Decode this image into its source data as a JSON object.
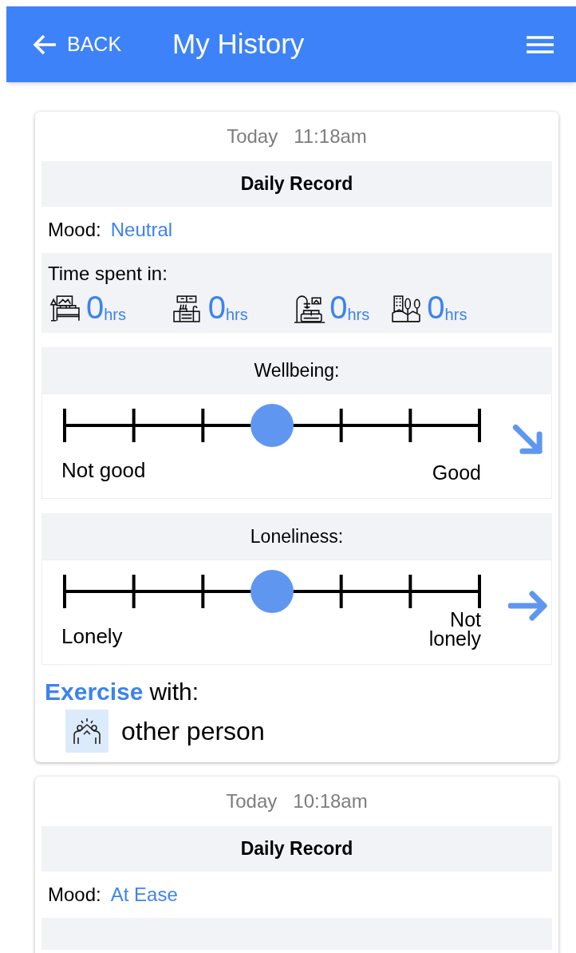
{
  "header": {
    "back_label": "BACK",
    "title": "My History"
  },
  "records": [
    {
      "date": "Today",
      "time": "11:18am",
      "title": "Daily Record",
      "mood_label": "Mood:",
      "mood": "Neutral",
      "time_spent": {
        "label": "Time spent in:",
        "places": [
          {
            "kind": "bedroom",
            "value": "0",
            "unit": "hrs"
          },
          {
            "kind": "kitchen",
            "value": "0",
            "unit": "hrs"
          },
          {
            "kind": "living-room",
            "value": "0",
            "unit": "hrs"
          },
          {
            "kind": "outside",
            "value": "0",
            "unit": "hrs"
          }
        ]
      },
      "scales": [
        {
          "title": "Wellbeing:",
          "level": 0.5,
          "low_label": "Not good",
          "high_label": "Good",
          "kind": "diagonal"
        },
        {
          "title": "Loneliness:",
          "level": 0.5,
          "low_label": "Lonely",
          "high_label": "Not lonely",
          "kind": "straight"
        }
      ],
      "exercise": {
        "activity": "Exercise",
        "label": "with:",
        "partner": "other person"
      }
    },
    {
      "date": "Today",
      "time": "10:18am",
      "title": "Daily Record",
      "mood_label": "Mood:",
      "mood": "At Ease"
    }
  ]
}
